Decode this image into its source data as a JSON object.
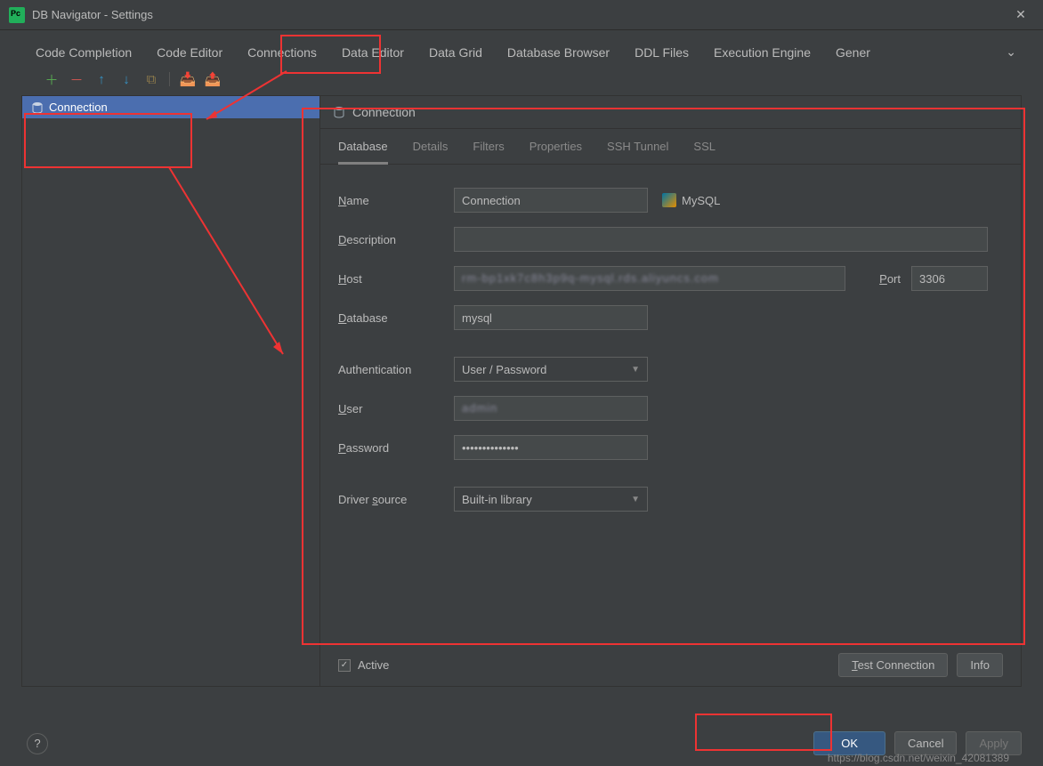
{
  "title": "DB Navigator - Settings",
  "tabs": [
    "Code Completion",
    "Code Editor",
    "Connections",
    "Data Editor",
    "Data Grid",
    "Database Browser",
    "DDL Files",
    "Execution Engine",
    "Gener"
  ],
  "sidebar": {
    "item": "Connection"
  },
  "panel": {
    "title": "Connection",
    "subtabs": [
      "Database",
      "Details",
      "Filters",
      "Properties",
      "SSH Tunnel",
      "SSL"
    ]
  },
  "labels": {
    "name": "ame",
    "nameU": "N",
    "description": "escription",
    "descriptionU": "D",
    "host": "ost",
    "hostU": "H",
    "port": "ort",
    "portU": "P",
    "database": "atabase",
    "databaseU": "D",
    "auth": "Authentication",
    "user": "ser",
    "userU": "U",
    "password": "assword",
    "passwordU": "P",
    "driver": "Driver ",
    "driverS": "s",
    "driverRest": "ource",
    "active": "Active"
  },
  "values": {
    "name": "Connection",
    "dbtype": "MySQL",
    "description": "",
    "host": "",
    "port": "3306",
    "database": "mysql",
    "auth": "User / Password",
    "user": "",
    "password": "••••••••••••••",
    "driver": "Built-in library"
  },
  "buttons": {
    "test": "Test Connection",
    "info": "Info",
    "ok": "OK",
    "cancel": "Cancel",
    "apply": "Apply"
  },
  "watermark": "https://blog.csdn.net/weixin_42081389"
}
